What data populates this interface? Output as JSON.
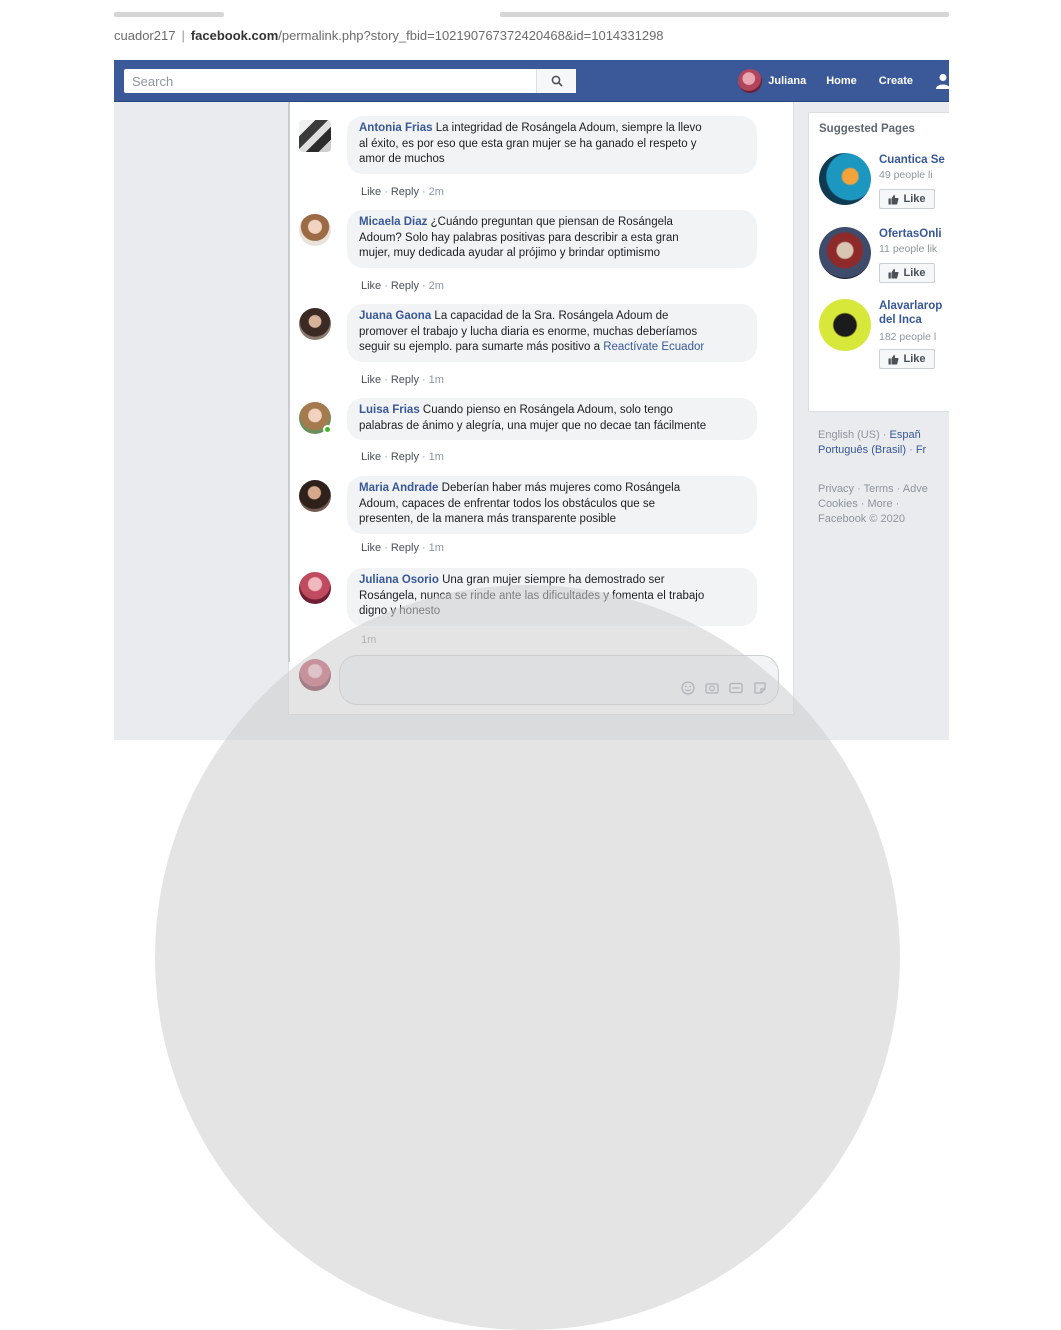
{
  "browser": {
    "url_prefix": "cuador217",
    "url_host": "facebook.com",
    "url_path": "/permalink.php?story_fbid=102190767372420468&id=1014331298"
  },
  "topbar": {
    "search_placeholder": "Search",
    "profile_name": "Juliana",
    "home": "Home",
    "create": "Create",
    "brand_color": "#3b5998"
  },
  "comments": [
    {
      "name": "Antonia Frias",
      "lines": [
        "La integridad de Rosángela Adoum, siempre la llevo",
        "al éxito, es por eso que esta gran mujer se ha ganado el respeto y",
        "amor de muchos"
      ],
      "like": "Like",
      "reply": "Reply",
      "time": "2m"
    },
    {
      "name": "Micaela Diaz",
      "lines": [
        "¿Cuándo preguntan que piensan de Rosángela",
        "Adoum? Solo hay palabras positivas para describir a esta gran",
        "mujer, muy dedicada ayudar al prójimo y brindar optimismo"
      ],
      "like": "Like",
      "reply": "Reply",
      "time": "2m"
    },
    {
      "name": "Juana Gaona",
      "lines": [
        "La capacidad de la Sra. Rosángela Adoum de",
        "promover el trabajo y lucha diaria es enorme, muchas deberíamos",
        "seguir su ejemplo. para sumarte más positivo a"
      ],
      "link": "Reactívate Ecuador",
      "like": "Like",
      "reply": "Reply",
      "time": "1m"
    },
    {
      "name": "Luisa Frias",
      "lines": [
        "Cuando pienso en Rosángela Adoum, solo tengo",
        "palabras de ánimo y alegría, una mujer que no decae tan fácilmente"
      ],
      "like": "Like",
      "reply": "Reply",
      "time": "1m"
    },
    {
      "name": "Maria Andrade",
      "lines": [
        "Deberían haber más mujeres como Rosángela",
        "Adoum, capaces de enfrentar todos los obstáculos que se",
        "presenten, de la manera más transparente posible"
      ],
      "like": "Like",
      "reply": "Reply",
      "time": "1m"
    },
    {
      "name": "Juliana Osorio",
      "lines": [
        "Una gran mujer siempre ha demostrado ser",
        "Rosángela, nunca se rinde ante las dificultades y fomenta el trabajo",
        "digno y honesto"
      ],
      "time": "1m"
    }
  ],
  "sidebar": {
    "heading": "Suggested Pages",
    "pages": [
      {
        "name": "Cuantica Se",
        "sub": "49 people li",
        "like": "Like"
      },
      {
        "name": "OfertasOnli",
        "sub": "11 people lik",
        "like": "Like"
      },
      {
        "name_line1": "Alavarlarop",
        "name_line2": "del Inca",
        "sub": "182 people l",
        "like": "Like"
      }
    ],
    "lang_line1_a": "English (US)",
    "lang_line1_b": "Españ",
    "lang_line2_a": "Português (Brasil)",
    "lang_line2_b": "Fr",
    "footer_line1": "Privacy · Terms · Adve",
    "footer_line2": "Cookies · More ·",
    "footer_line3": "Facebook © 2020"
  }
}
